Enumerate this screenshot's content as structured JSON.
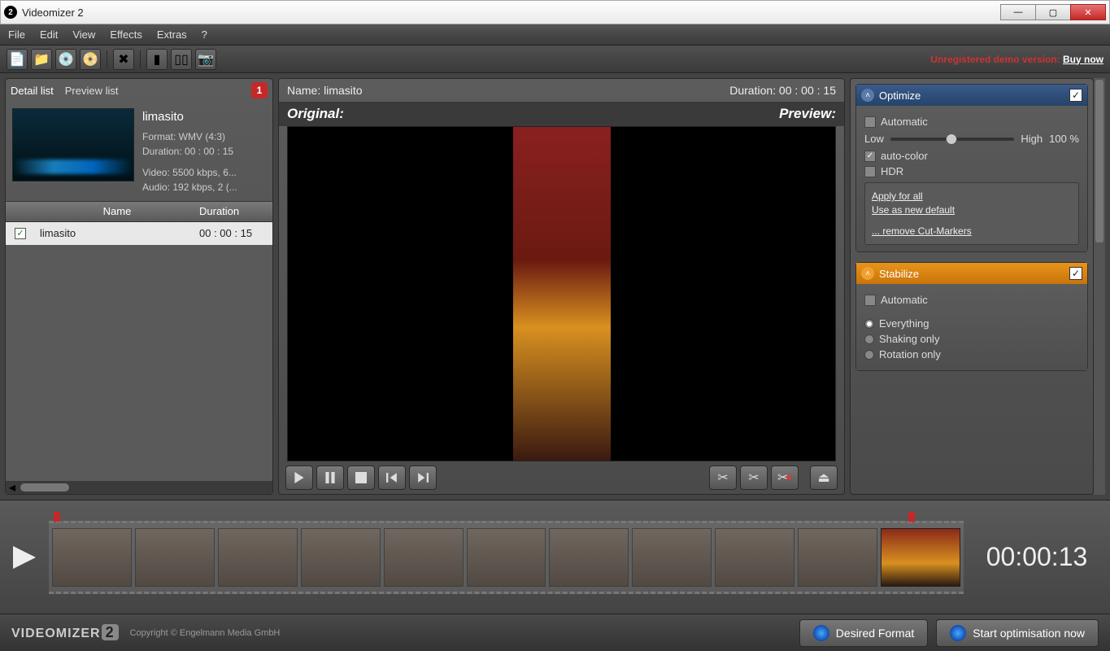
{
  "window": {
    "title": "Videomizer 2"
  },
  "menu": {
    "file": "File",
    "edit": "Edit",
    "view": "View",
    "effects": "Effects",
    "extras": "Extras",
    "help": "?"
  },
  "demo_msg": "Unregistered demo version:",
  "buy_now": "Buy now",
  "left": {
    "tab_detail": "Detail list",
    "tab_preview": "Preview list",
    "badge": "1",
    "video_name": "limasito",
    "format": "Format: WMV (4:3)",
    "duration": "Duration: 00 : 00 : 15",
    "video_spec": "Video: 5500 kbps, 6...",
    "audio_spec": "Audio: 192 kbps, 2 (...",
    "col_name": "Name",
    "col_dur": "Duration",
    "row_name": "limasito",
    "row_dur": "00 : 00 : 15"
  },
  "center": {
    "name_label": "Name: limasito",
    "duration_label": "Duration: 00 : 00 : 15",
    "original": "Original:",
    "preview": "Preview:"
  },
  "right": {
    "optimize": "Optimize",
    "automatic": "Automatic",
    "low": "Low",
    "high": "High",
    "percent": "100  %",
    "autocolor": "auto-color",
    "hdr": "HDR",
    "apply_all": "Apply for all",
    "new_default": "Use as new default",
    "remove_markers": "... remove Cut-Markers",
    "stabilize": "Stabilize",
    "everything": "Everything",
    "shaking": "Shaking only",
    "rotation": "Rotation only"
  },
  "timeline": {
    "code": "00:00:13"
  },
  "footer": {
    "logo": "VIDEOMIZER",
    "logo_n": "2",
    "copyright": "Copyright © Engelmann Media GmbH",
    "desired_format": "Desired Format",
    "start_opt": "Start optimisation now"
  }
}
